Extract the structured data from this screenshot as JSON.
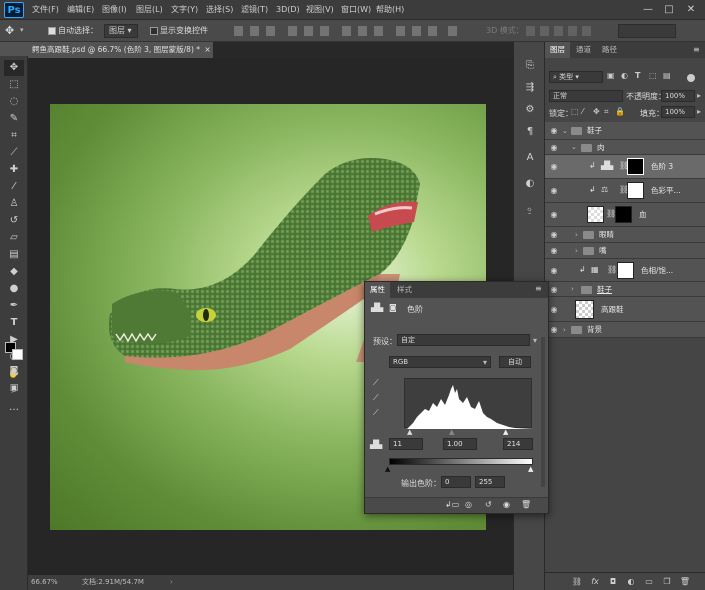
{
  "app": {
    "logo": "Ps"
  },
  "menu": [
    "文件(F)",
    "编辑(E)",
    "图像(I)",
    "图层(L)",
    "文字(Y)",
    "选择(S)",
    "滤镜(T)",
    "3D(D)",
    "视图(V)",
    "窗口(W)",
    "帮助(H)"
  ],
  "window_controls": {
    "minimize": "—",
    "maximize": "□",
    "close": "✕"
  },
  "options": {
    "auto_select_label": "自动选择：",
    "auto_select_value": "图层",
    "show_transform_label": "显示变换控件",
    "mode_3d_label": "3D 模式："
  },
  "document": {
    "tab_title": "鳄鱼高跟鞋.psd @ 66.7% (色阶 3, 图层蒙版/8) *",
    "close": "×"
  },
  "status": {
    "zoom": "66.67%",
    "doc_info": "文档:2.91M/54.7M"
  },
  "layers_panel": {
    "tabs": [
      "图层",
      "通道",
      "路径"
    ],
    "kind_filter": "类型",
    "blend_mode": "正常",
    "opacity_label": "不透明度：",
    "opacity_value": "100%",
    "lock_label": "锁定：",
    "fill_label": "填充：",
    "fill_value": "100%",
    "rows": [
      {
        "name": "鞋子"
      },
      {
        "name": "肉"
      },
      {
        "name": "色阶 3"
      },
      {
        "name": "色彩平..."
      },
      {
        "name": "血"
      },
      {
        "name": "眼睛"
      },
      {
        "name": "嘴"
      },
      {
        "name": "色相/饱..."
      },
      {
        "name": "鞋子"
      },
      {
        "name": "高跟鞋"
      },
      {
        "name": "背景"
      }
    ]
  },
  "properties_panel": {
    "tabs": [
      "属性",
      "样式"
    ],
    "adjustment_name": "色阶",
    "preset_label": "预设：",
    "preset_value": "自定",
    "channel_value": "RGB",
    "auto_button": "自动",
    "input_black": "11",
    "input_gamma": "1.00",
    "input_white": "214",
    "output_label": "输出色阶：",
    "output_black": "0",
    "output_white": "255"
  }
}
